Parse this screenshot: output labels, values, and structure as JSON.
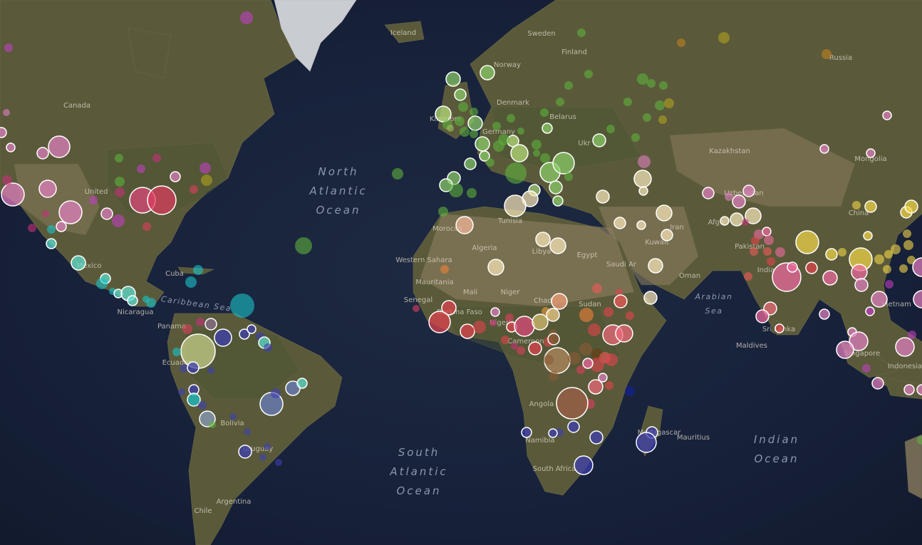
{
  "map": {
    "ocean_labels": [
      {
        "id": "north-atlantic",
        "lines": [
          "North",
          "Atlantic",
          "Ocean"
        ]
      },
      {
        "id": "south-atlantic",
        "lines": [
          "South",
          "Atlantic",
          "Ocean"
        ]
      },
      {
        "id": "indian",
        "lines": [
          "Indian",
          "Ocean"
        ]
      }
    ],
    "sea_labels": [
      {
        "id": "caribbean-sea",
        "text": "Caribbean Sea"
      },
      {
        "id": "arabian-sea",
        "lines": [
          "Arabian",
          "Sea"
        ]
      }
    ],
    "country_labels": [
      "Canada",
      "United",
      "Mexico",
      "Cuba",
      "Nicaragua",
      "Panama",
      "Ecuador",
      "Bolivia",
      "Uruguay",
      "Argentina",
      "Chile",
      "Iceland",
      "Norway",
      "Sweden",
      "Finland",
      "Denmark",
      "Kingdom",
      "Germany",
      "Belarus",
      "Ukr",
      "Russia",
      "Kazakhstan",
      "Uzbekistan",
      "Mongolia",
      "Afgh",
      "Iran",
      "Pakistan",
      "India",
      "China",
      "Tunisia",
      "Morocco",
      "Algeria",
      "Libya",
      "Egypt",
      "Saudi Ar",
      "Oman",
      "Kuwait",
      "Western Sahara",
      "Mauritania",
      "Mali",
      "Niger",
      "Chad",
      "Sudan",
      "Senegal",
      "Burkina Faso",
      "Nigeria",
      "Cameroon",
      "Angola",
      "Namibia",
      "South Africa",
      "Madagascar",
      "Mauritius",
      "Maldives",
      "Sri Lanka",
      "Singapore",
      "Indonesia",
      "Vietnam"
    ],
    "palette": {
      "ocean": "#17213a",
      "americas_pink": "#e07fbf",
      "americas_red": "#dd3d5e",
      "caribbean_cyan": "#19c3c8",
      "south_america_blue": "#3d3fb0",
      "europe_green": "#5fb03c",
      "mena_cream": "#f6e6b8",
      "africa_red": "#e2434c",
      "africa_brown": "#8a5a34",
      "asia_yellow": "#f3d54a",
      "asia_pink": "#ef6aa0"
    },
    "marker_count": 265
  }
}
